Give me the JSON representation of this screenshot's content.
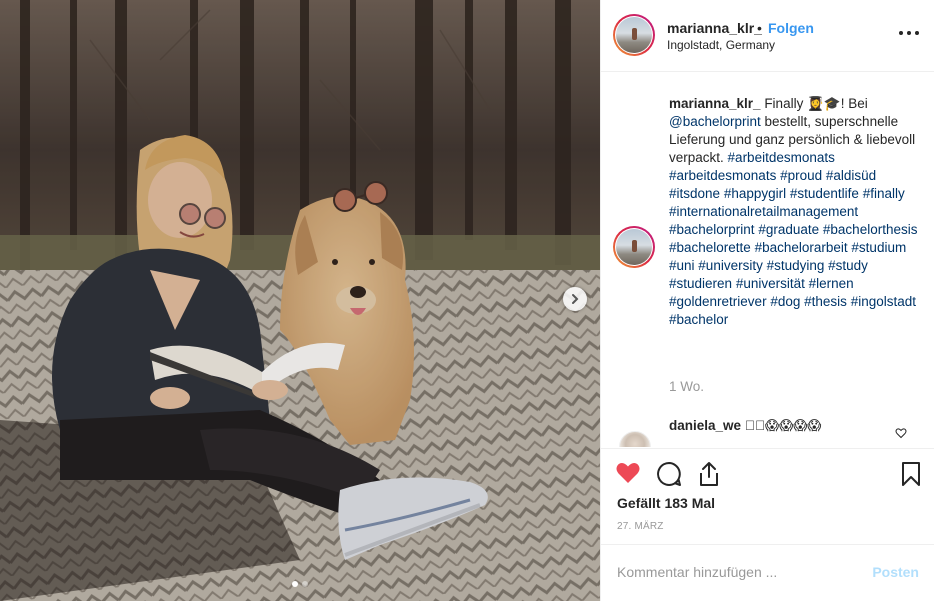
{
  "post": {
    "username": "marianna_klr_",
    "separator": "•",
    "follow_label": "Folgen",
    "location": "Ingolstadt, Germany",
    "more_icon": "more-horizontal-icon"
  },
  "caption": {
    "username": "marianna_klr_",
    "text_start": " Finally 👩‍🎓🎓! Bei ",
    "mention": "@bachelorprint",
    "text_mid": " bestellt, superschnelle Lieferung und ganz persönlich & liebevoll verpackt.",
    "hashtags": [
      "#arbeitdesmonats",
      "#arbeitdesmonats",
      "#proud",
      "#aldisüd",
      "#itsdone",
      "#happygirl",
      "#studentlife",
      "#finally",
      "#internationalretailmanagement",
      "#bachelorprint",
      "#graduate",
      "#bachelorthesis",
      "#bachelorette",
      "#bachelorarbeit",
      "#studium",
      "#uni",
      "#university",
      "#studying",
      "#study",
      "#studieren",
      "#universität",
      "#lernen",
      "#goldenretriever",
      "#dog",
      "#thesis",
      "#ingolstadt",
      "#bachelor"
    ],
    "time_ago": "1 Wo."
  },
  "comment": {
    "username": "daniela_we",
    "text": "  ⃞⃞😱😱😱😱"
  },
  "actions": {
    "likes": "Gefällt 183 Mal",
    "date": "27. MÄRZ",
    "liked": true,
    "like_color": "#ed4956"
  },
  "comment_box": {
    "placeholder": "Kommentar hinzufügen ...",
    "post_label": "Posten"
  },
  "carousel": {
    "slides": 2,
    "active": 1
  }
}
